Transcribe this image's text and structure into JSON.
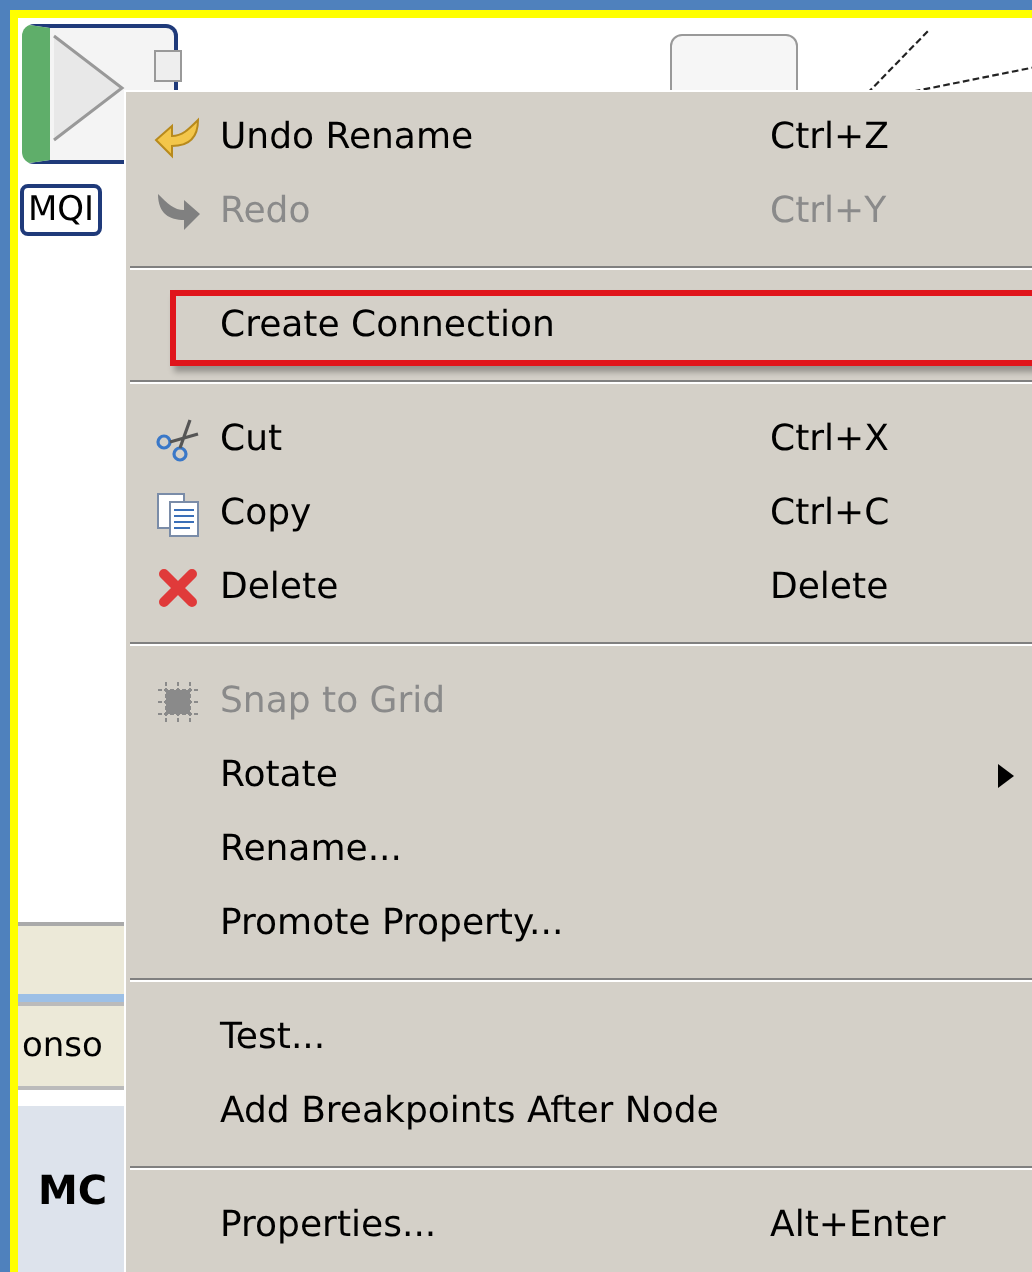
{
  "canvas": {
    "node_label": "MQI"
  },
  "panel": {
    "tab": "onso",
    "heading": "MC"
  },
  "menu": {
    "items": [
      {
        "kind": "item",
        "label": "Undo Rename",
        "shortcut": "Ctrl+Z",
        "disabled": false,
        "highlighted": false,
        "submenu": false
      },
      {
        "kind": "item",
        "label": "Redo",
        "shortcut": "Ctrl+Y",
        "disabled": true,
        "highlighted": false,
        "submenu": false
      },
      {
        "kind": "separator"
      },
      {
        "kind": "item",
        "label": "Create Connection",
        "disabled": false,
        "highlighted": true,
        "submenu": false
      },
      {
        "kind": "separator"
      },
      {
        "kind": "item",
        "label": "Cut",
        "shortcut": "Ctrl+X",
        "disabled": false,
        "highlighted": false,
        "submenu": false
      },
      {
        "kind": "item",
        "label": "Copy",
        "shortcut": "Ctrl+C",
        "disabled": false,
        "highlighted": false,
        "submenu": false
      },
      {
        "kind": "item",
        "label": "Delete",
        "shortcut": "Delete",
        "disabled": false,
        "highlighted": false,
        "submenu": false
      },
      {
        "kind": "separator"
      },
      {
        "kind": "item",
        "label": "Snap to Grid",
        "disabled": true,
        "highlighted": false,
        "submenu": false
      },
      {
        "kind": "item",
        "label": "Rotate",
        "disabled": false,
        "highlighted": false,
        "submenu": true
      },
      {
        "kind": "item",
        "label": "Rename...",
        "disabled": false,
        "highlighted": false,
        "submenu": false
      },
      {
        "kind": "item",
        "label": "Promote Property...",
        "disabled": false,
        "highlighted": false,
        "submenu": false
      },
      {
        "kind": "separator"
      },
      {
        "kind": "item",
        "label": "Test...",
        "disabled": false,
        "highlighted": false,
        "submenu": false
      },
      {
        "kind": "item",
        "label": "Add Breakpoints After Node",
        "disabled": false,
        "highlighted": false,
        "submenu": false
      },
      {
        "kind": "separator"
      },
      {
        "kind": "item",
        "label": "Properties...",
        "shortcut": "Alt+Enter",
        "disabled": false,
        "highlighted": false,
        "submenu": false
      }
    ]
  }
}
